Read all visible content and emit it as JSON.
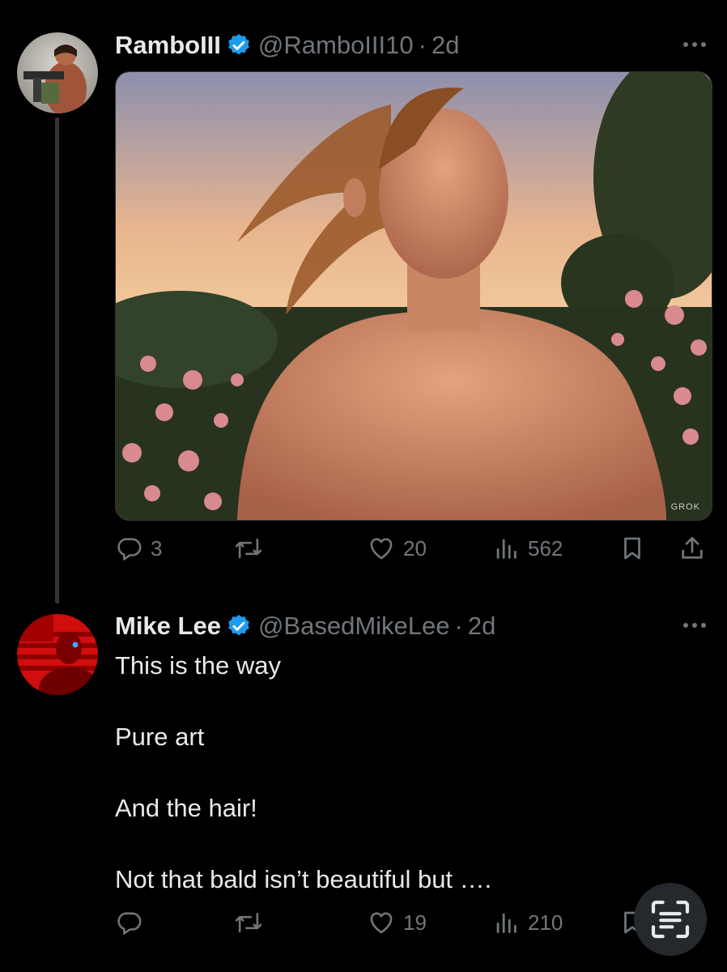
{
  "tweet1": {
    "name": "RamboIII",
    "handle": "@RamboIII10",
    "separator": "·",
    "time": "2d",
    "image_watermark": "GROK",
    "actions": {
      "replies": "3",
      "retweets": "",
      "likes": "20",
      "views": "562"
    }
  },
  "tweet2": {
    "name": "Mike Lee",
    "handle": "@BasedMikeLee",
    "separator": "·",
    "time": "2d",
    "lines": [
      "This is the way",
      "Pure art",
      "And the hair!",
      "Not that bald isn’t beautiful but …."
    ],
    "actions": {
      "replies": "",
      "retweets": "",
      "likes": "19",
      "views": "210"
    }
  },
  "colors": {
    "background": "#000000",
    "muted": "#71767b",
    "verified": "#1d9bf0",
    "text": "#e7e9ea"
  },
  "icons": [
    "reply-icon",
    "retweet-icon",
    "like-icon",
    "views-icon",
    "bookmark-icon",
    "share-icon",
    "verified-icon",
    "more-icon",
    "reader-icon"
  ]
}
